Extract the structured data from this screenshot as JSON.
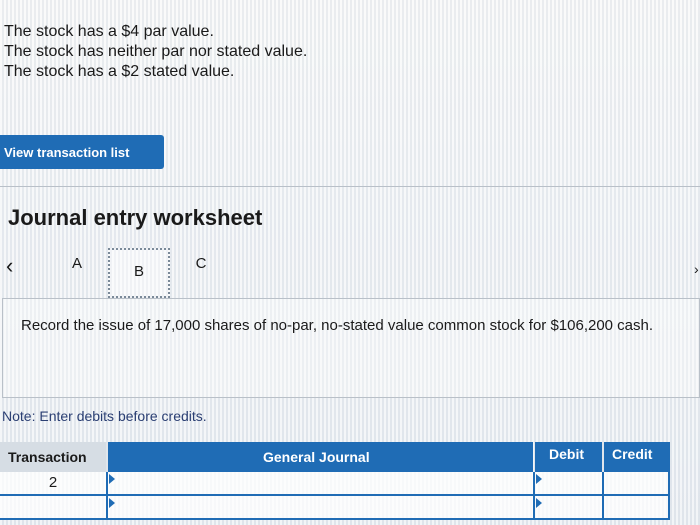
{
  "options": [
    "The stock has a $4 par value.",
    "The stock has neither par nor stated value.",
    "The stock has a $2 stated value."
  ],
  "buttons": {
    "view_transaction_list": "View transaction list"
  },
  "worksheet": {
    "title": "Journal entry worksheet",
    "tabs": [
      "A",
      "B",
      "C"
    ],
    "active_tab": "B",
    "instruction": "Record the issue of 17,000 shares of no-par, no-stated value common stock for $106,200 cash.",
    "note": "Note: Enter debits before credits."
  },
  "journal_table": {
    "headers": {
      "transaction": "Transaction",
      "general_journal": "General Journal",
      "debit": "Debit",
      "credit": "Credit"
    },
    "rows": [
      {
        "transaction": "2",
        "account": "",
        "debit": "",
        "credit": ""
      },
      {
        "transaction": "",
        "account": "",
        "debit": "",
        "credit": ""
      }
    ]
  },
  "colors": {
    "accent": "#1f6cb5",
    "note_text": "#2b3f73"
  },
  "icons": {
    "prev": "chevron-left-icon",
    "next": "chevron-right-icon"
  }
}
